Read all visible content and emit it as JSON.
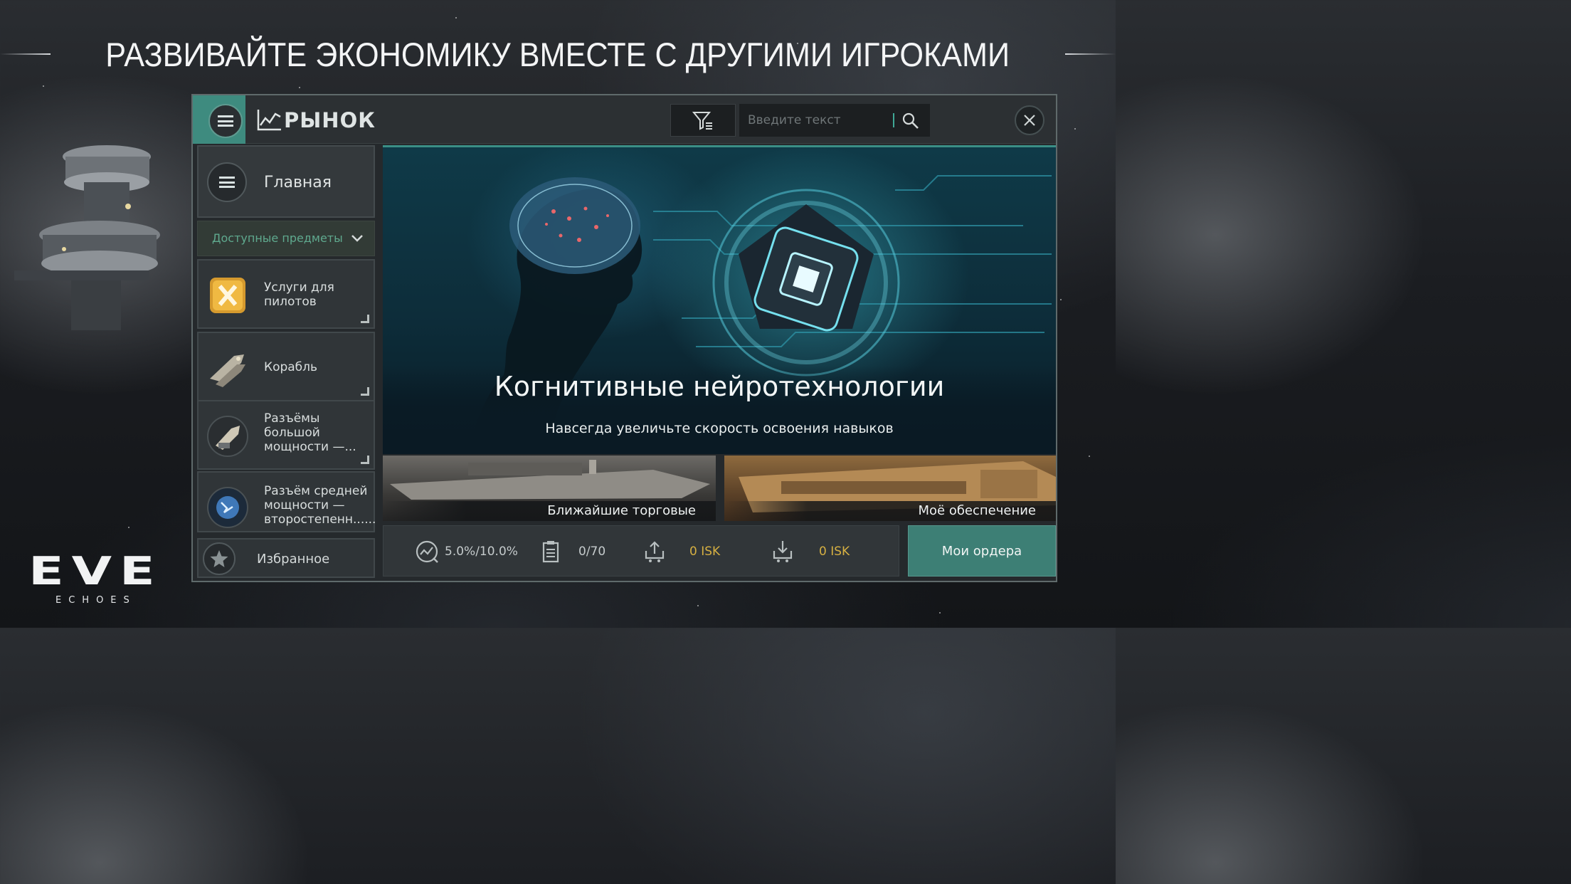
{
  "headline": "РАЗВИВАЙТЕ ЭКОНОМИКУ ВМЕСТЕ С ДРУГИМИ ИГРОКАМИ",
  "logo": {
    "main": "EVE",
    "sub": "ECHOES"
  },
  "market": {
    "title": "РЫНОК",
    "search_placeholder": "Введите текст"
  },
  "sidebar": {
    "home_label": "Главная",
    "available_label": "Доступные предметы",
    "categories": [
      {
        "label": "Услуги для\n пилотов",
        "icon": "pilot-services-icon"
      },
      {
        "label": "Корабль",
        "icon": "ship-icon"
      },
      {
        "label": "Разъёмы\n большой\n мощности —...",
        "icon": "high-slot-module-icon"
      },
      {
        "label": "Разъём средней\nмощности —\n второстепенн......",
        "icon": "mid-slot-module-icon"
      }
    ],
    "favorites_label": "Избранное"
  },
  "banner": {
    "title": "Когнитивные нейротехнологии",
    "subtitle": "Навсегда увеличьте скорость освоения навыков"
  },
  "tiles": [
    {
      "label": "Ближайшие торговые центры"
    },
    {
      "label": "Моё обеспечение"
    }
  ],
  "stats": {
    "tax": "5.0%/10.0%",
    "orders_count": "0/70",
    "sell_value": "0 ISK",
    "buy_value": "0 ISK"
  },
  "orders_button": "Мои ордера",
  "colors": {
    "accent_teal": "#3e8b7f",
    "isk_gold": "#d6b042",
    "available_green": "#5fa98e"
  }
}
